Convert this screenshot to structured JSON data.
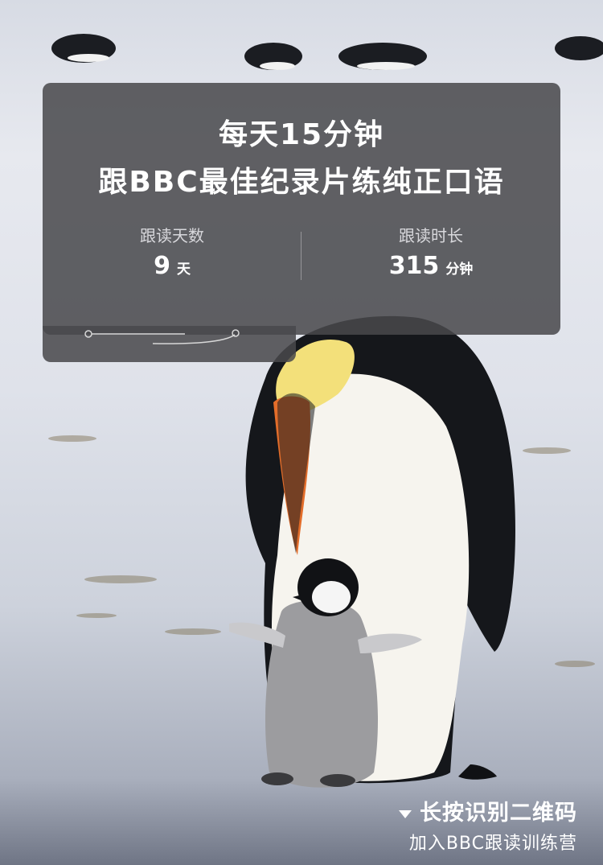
{
  "headline": {
    "line1": "每天15分钟",
    "line2": "跟BBC最佳纪录片练纯正口语"
  },
  "stats": {
    "days": {
      "label": "跟读天数",
      "value": "9",
      "unit": "天"
    },
    "duration": {
      "label": "跟读时长",
      "value": "315",
      "unit": "分钟"
    }
  },
  "cta": {
    "main": "长按识别二维码",
    "sub": "加入BBC跟读训练营"
  },
  "colors": {
    "card": "#48484c",
    "text": "#ffffff"
  }
}
